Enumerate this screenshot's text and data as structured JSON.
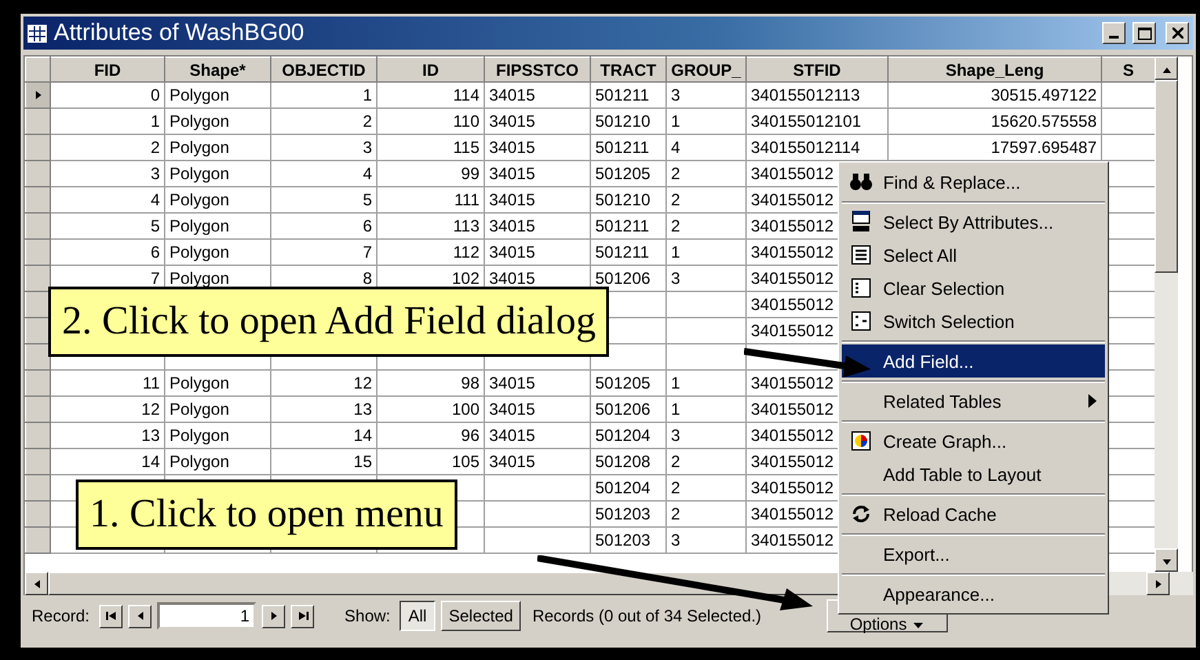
{
  "window": {
    "title": "Attributes of WashBG00"
  },
  "table": {
    "columns": [
      {
        "label": "FID"
      },
      {
        "label": "Shape*"
      },
      {
        "label": "OBJECTID"
      },
      {
        "label": "ID"
      },
      {
        "label": "FIPSSTCO"
      },
      {
        "label": "TRACT"
      },
      {
        "label": "GROUP_"
      },
      {
        "label": "STFID"
      },
      {
        "label": "Shape_Leng"
      },
      {
        "label": "S"
      }
    ],
    "rows": [
      {
        "current": true,
        "cells": [
          "0",
          "Polygon",
          "1",
          "114",
          "34015",
          "501211",
          "3",
          "340155012113",
          "30515.497122"
        ]
      },
      {
        "current": false,
        "cells": [
          "1",
          "Polygon",
          "2",
          "110",
          "34015",
          "501210",
          "1",
          "340155012101",
          "15620.575558"
        ]
      },
      {
        "current": false,
        "cells": [
          "2",
          "Polygon",
          "3",
          "115",
          "34015",
          "501211",
          "4",
          "340155012114",
          "17597.695487"
        ]
      },
      {
        "current": false,
        "cells": [
          "3",
          "Polygon",
          "4",
          "99",
          "34015",
          "501205",
          "2",
          "340155012"
        ]
      },
      {
        "current": false,
        "cells": [
          "4",
          "Polygon",
          "5",
          "111",
          "34015",
          "501210",
          "2",
          "340155012"
        ]
      },
      {
        "current": false,
        "cells": [
          "5",
          "Polygon",
          "6",
          "113",
          "34015",
          "501211",
          "2",
          "340155012"
        ]
      },
      {
        "current": false,
        "cells": [
          "6",
          "Polygon",
          "7",
          "112",
          "34015",
          "501211",
          "1",
          "340155012"
        ]
      },
      {
        "current": false,
        "cells": [
          "7",
          "Polygon",
          "8",
          "102",
          "34015",
          "501206",
          "3",
          "340155012"
        ]
      },
      {
        "current": false,
        "cells": [
          null,
          null,
          null,
          null,
          null,
          null,
          null,
          "340155012"
        ]
      },
      {
        "current": false,
        "cells": [
          null,
          null,
          null,
          null,
          null,
          null,
          null,
          "340155012"
        ]
      },
      {
        "current": false,
        "cells": []
      },
      {
        "current": false,
        "cells": [
          "11",
          "Polygon",
          "12",
          "98",
          "34015",
          "501205",
          "1",
          "340155012"
        ]
      },
      {
        "current": false,
        "cells": [
          "12",
          "Polygon",
          "13",
          "100",
          "34015",
          "501206",
          "1",
          "340155012"
        ]
      },
      {
        "current": false,
        "cells": [
          "13",
          "Polygon",
          "14",
          "96",
          "34015",
          "501204",
          "3",
          "340155012"
        ]
      },
      {
        "current": false,
        "cells": [
          "14",
          "Polygon",
          "15",
          "105",
          "34015",
          "501208",
          "2",
          "340155012"
        ]
      },
      {
        "current": false,
        "cells": [
          null,
          null,
          null,
          null,
          null,
          "501204",
          "2",
          "340155012"
        ]
      },
      {
        "current": false,
        "cells": [
          null,
          null,
          null,
          null,
          null,
          "501203",
          "2",
          "340155012"
        ]
      },
      {
        "current": false,
        "cells": [
          null,
          null,
          null,
          null,
          null,
          "501203",
          "3",
          "340155012"
        ]
      }
    ]
  },
  "record_bar": {
    "record_label": "Record:",
    "record_value": "1",
    "show_label": "Show:",
    "show_buttons": [
      {
        "label": "All",
        "selected": true
      },
      {
        "label": "Selected",
        "selected": false
      }
    ],
    "records_text": "Records (0 out of 34 Selected.)",
    "options_button": "Options"
  },
  "menu": [
    {
      "kind": "item",
      "label": "Find & Replace...",
      "selected": false
    },
    {
      "kind": "separator"
    },
    {
      "kind": "item",
      "label": "Select By Attributes...",
      "selected": false
    },
    {
      "kind": "item",
      "label": "Select All",
      "selected": false
    },
    {
      "kind": "item",
      "label": "Clear Selection",
      "selected": false
    },
    {
      "kind": "item",
      "label": "Switch Selection",
      "selected": false
    },
    {
      "kind": "separator"
    },
    {
      "kind": "item",
      "label": "Add Field...",
      "selected": true
    },
    {
      "kind": "separator"
    },
    {
      "kind": "submenu",
      "label": "Related Tables",
      "selected": false
    },
    {
      "kind": "separator"
    },
    {
      "kind": "item",
      "label": "Create Graph...",
      "selected": false
    },
    {
      "kind": "item",
      "label": "Add Table to Layout",
      "selected": false
    },
    {
      "kind": "separator"
    },
    {
      "kind": "item",
      "label": "Reload Cache",
      "selected": false
    },
    {
      "kind": "separator"
    },
    {
      "kind": "item",
      "label": "Export...",
      "selected": false
    },
    {
      "kind": "separator"
    },
    {
      "kind": "item",
      "label": "Appearance...",
      "selected": false
    }
  ],
  "callouts": [
    {
      "text": "2. Click to open Add Field dialog"
    },
    {
      "text": "1. Click to open menu"
    }
  ]
}
